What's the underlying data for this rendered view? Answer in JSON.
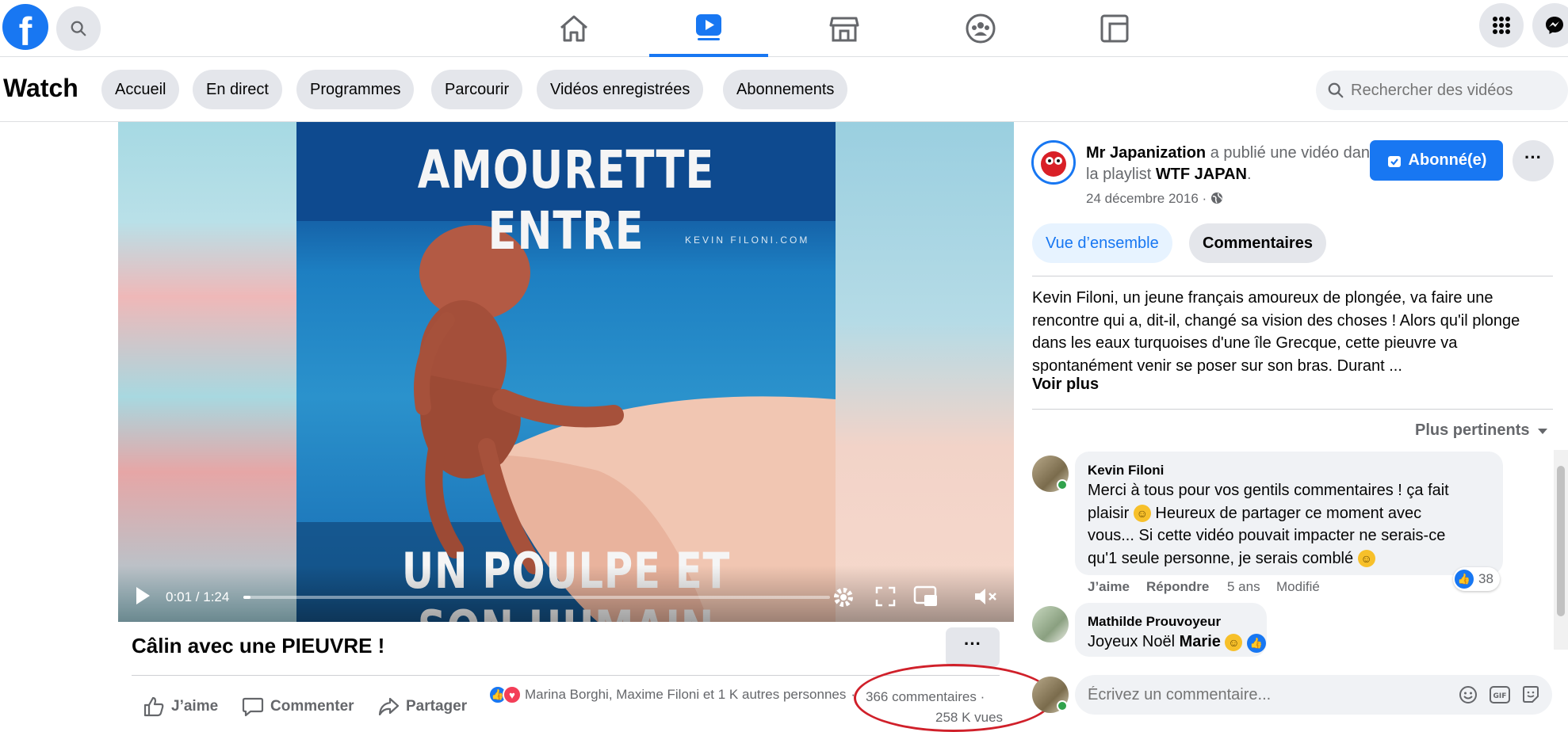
{
  "topbar": {
    "logo": "f",
    "nav": [
      {
        "name": "home",
        "icon": "home-icon"
      },
      {
        "name": "watch",
        "icon": "watch-icon"
      },
      {
        "name": "marketplace",
        "icon": "marketplace-icon"
      },
      {
        "name": "groups",
        "icon": "groups-icon"
      },
      {
        "name": "gaming",
        "icon": "gaming-icon"
      }
    ],
    "accent": "#1877f2"
  },
  "watchbar": {
    "title": "Watch",
    "tabs": [
      "Accueil",
      "En direct",
      "Programmes",
      "Parcourir",
      "Vidéos enregistrées",
      "Abonnements"
    ],
    "search_placeholder": "Rechercher des vidéos"
  },
  "video": {
    "caption_top": "AMOURETTE ENTRE",
    "caption_bottom": "UN POULPE ET SON HUMAIN",
    "watermark": "KEVIN FILONI.COM",
    "time": "0:01 / 1:24",
    "progress": 0.012,
    "title": "Câlin avec une PIEUVRE !",
    "more_label": "···"
  },
  "actions": {
    "like": "J’aime",
    "comment": "Commenter",
    "share": "Partager"
  },
  "stats": {
    "reactions_text": "Marina Borghi, Maxime Filoni et 1 K autres personnes",
    "comments": "366 commentaires",
    "separator": "·",
    "views": "258 K vues"
  },
  "post": {
    "author": "Mr Japanization",
    "action_text": " a publié une vidéo dans la playlist ",
    "playlist": "WTF JAPAN",
    "period": ".",
    "date": "24 décembre 2016 ·",
    "subscribe_label": "Abonné(e)",
    "dots_label": "···",
    "tabs": [
      "Vue d’ensemble",
      "Commentaires"
    ],
    "description": "Kevin Filoni, un jeune français amoureux de plongée, va faire une rencontre qui a, dit-il, changé sa vision des choses ! Alors qu'il plonge dans les eaux turquoises d'une île Grecque, cette pieuvre va spontanément venir se poser sur son bras. Durant ...",
    "see_more": "Voir plus",
    "sort_label": "Plus pertinents"
  },
  "comments": [
    {
      "author": "Kevin Filoni",
      "text_1": "Merci à tous pour vos gentils commentaires ! ça fait",
      "text_2": "plaisir",
      "text_3": "Heureux de partager ce moment avec",
      "text_4": "vous... Si cette vidéo pouvait impacter ne serais-ce",
      "text_5": "qu'1 seule personne, je serais comblé",
      "like": "J’aime",
      "reply": "Répondre",
      "age": "5 ans",
      "edited": "Modifié",
      "like_count": "38"
    },
    {
      "author": "Mathilde Prouvoyeur",
      "text": "Joyeux Noël",
      "mention": "Marie"
    }
  ],
  "comment_input": {
    "placeholder": "Écrivez un commentaire..."
  }
}
